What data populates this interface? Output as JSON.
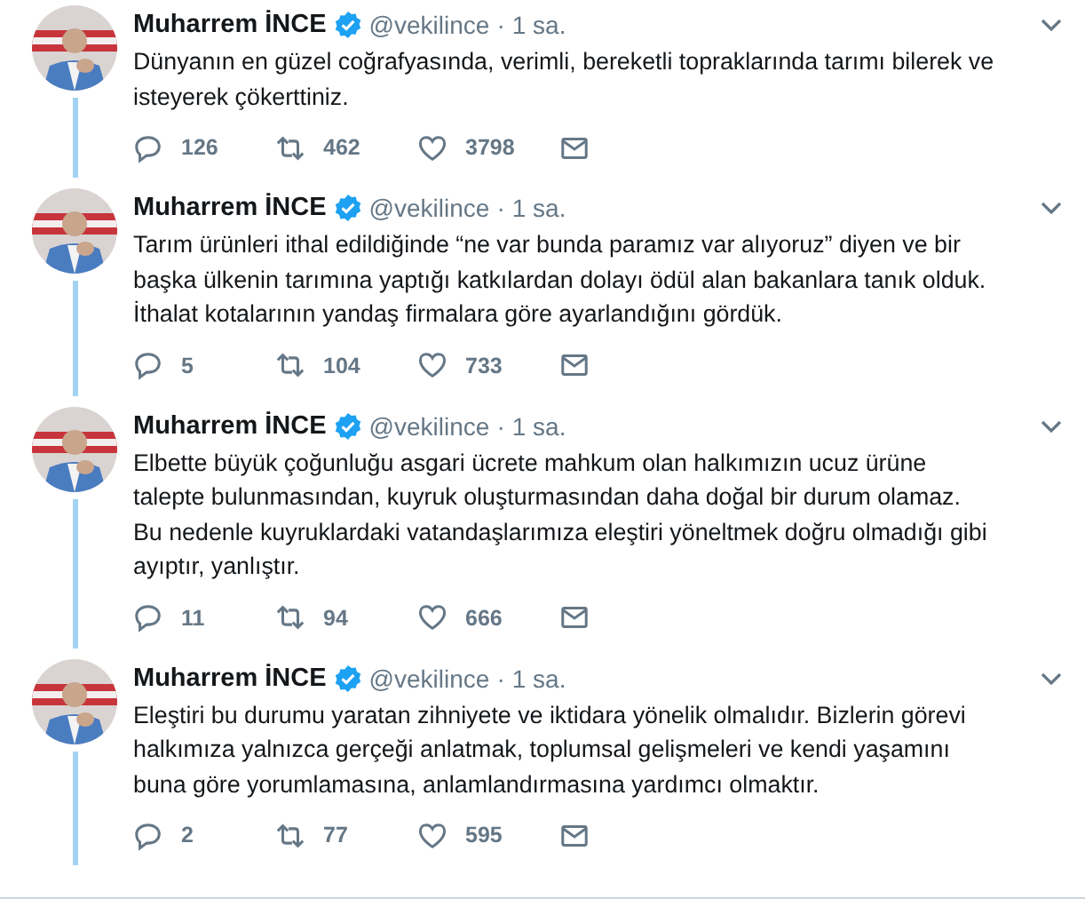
{
  "tweets": [
    {
      "author": "Muharrem İNCE",
      "verified": true,
      "handle": "@vekilince",
      "separator": "·",
      "time": "1 sa.",
      "text": "Dünyanın en güzel coğrafyasında, verimli, bereketli topraklarında tarımı bilerek ve\nisteyerek çökerttiniz.",
      "replies": "126",
      "retweets": "462",
      "likes": "3798"
    },
    {
      "author": "Muharrem İNCE",
      "verified": true,
      "handle": "@vekilince",
      "separator": "·",
      "time": "1 sa.",
      "text": "Tarım ürünleri ithal edildiğinde “ne var bunda paramız var alıyoruz” diyen ve bir\nbaşka ülkenin tarımına yaptığı katkılardan dolayı ödül alan bakanlara tanık olduk.\nİthalat kotalarının yandaş firmalara göre ayarlandığını gördük.",
      "replies": "5",
      "retweets": "104",
      "likes": "733"
    },
    {
      "author": "Muharrem İNCE",
      "verified": true,
      "handle": "@vekilince",
      "separator": "·",
      "time": "1 sa.",
      "text": "Elbette büyük çoğunluğu asgari ücrete mahkum olan halkımızın ucuz ürüne\ntalepte bulunmasından, kuyruk oluşturmasından daha doğal bir durum olamaz.\nBu nedenle kuyruklardaki vatandaşlarımıza eleştiri yöneltmek doğru olmadığı gibi\nayıptır, yanlıştır.",
      "replies": "11",
      "retweets": "94",
      "likes": "666"
    },
    {
      "author": "Muharrem İNCE",
      "verified": true,
      "handle": "@vekilince",
      "separator": "·",
      "time": "1 sa.",
      "text": "Eleştiri bu durumu yaratan zihniyete ve iktidara yönelik olmalıdır. Bizlerin görevi\nhalkımıza yalnızca gerçeği anlatmak, toplumsal gelişmeleri ve kendi yaşamını\nbuna göre yorumlamasına, anlamlandırmasına yardımcı olmaktır.",
      "replies": "2",
      "retweets": "77",
      "likes": "595"
    }
  ]
}
